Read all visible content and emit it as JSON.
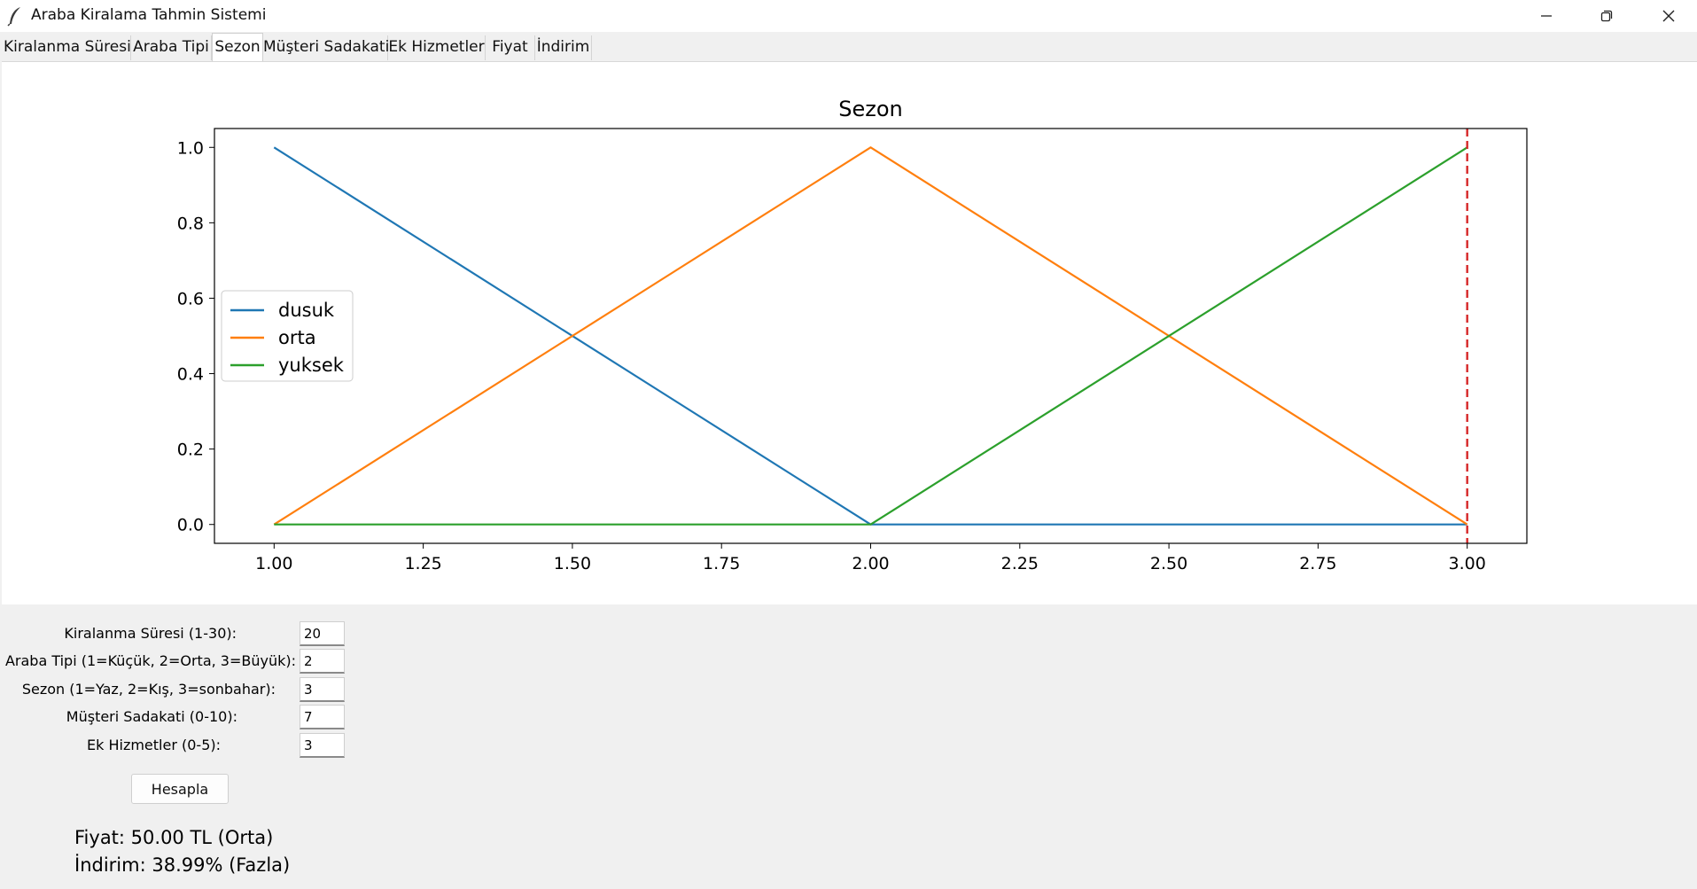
{
  "window": {
    "title": "Araba Kiralama Tahmin Sistemi"
  },
  "tabs": [
    {
      "label": "Kiralanma Süresi",
      "active": false
    },
    {
      "label": "Araba Tipi",
      "active": false
    },
    {
      "label": "Sezon",
      "active": true
    },
    {
      "label": "Müşteri Sadakati",
      "active": false
    },
    {
      "label": "Ek Hizmetler",
      "active": false
    },
    {
      "label": "Fiyat",
      "active": false
    },
    {
      "label": "İndirim",
      "active": false
    }
  ],
  "chart_data": {
    "type": "line",
    "title": "Sezon",
    "xlabel": "",
    "ylabel": "",
    "xlim": [
      0.9,
      3.1
    ],
    "ylim": [
      -0.05,
      1.05
    ],
    "xticks": [
      "1.00",
      "1.25",
      "1.50",
      "1.75",
      "2.00",
      "2.25",
      "2.50",
      "2.75",
      "3.00"
    ],
    "yticks": [
      "0.0",
      "0.2",
      "0.4",
      "0.6",
      "0.8",
      "1.0"
    ],
    "legend_position": "center-left",
    "grid": false,
    "series": [
      {
        "name": "dusuk",
        "color": "#1f77b4",
        "x": [
          1,
          2,
          3
        ],
        "y": [
          1,
          0,
          0
        ]
      },
      {
        "name": "orta",
        "color": "#ff7f0e",
        "x": [
          1,
          2,
          3
        ],
        "y": [
          0,
          1,
          0
        ]
      },
      {
        "name": "yuksek",
        "color": "#2ca02c",
        "x": [
          1,
          2,
          3
        ],
        "y": [
          0,
          0,
          1
        ]
      }
    ],
    "vline": {
      "x": 3.0,
      "color": "#d62728",
      "style": "dashed"
    }
  },
  "form": {
    "fields": [
      {
        "label": "Kiralanma Süresi (1-30):",
        "value": "20"
      },
      {
        "label": "Araba Tipi (1=Küçük, 2=Orta, 3=Büyük):",
        "value": "2"
      },
      {
        "label": "Sezon (1=Yaz, 2=Kış, 3=sonbahar):",
        "value": "3"
      },
      {
        "label": "Müşteri Sadakati (0-10):",
        "value": "7"
      },
      {
        "label": "Ek Hizmetler (0-5):",
        "value": "3"
      }
    ],
    "button_label": "Hesapla"
  },
  "results": {
    "price": "Fiyat: 50.00 TL (Orta)",
    "discount": "İndirim: 38.99% (Fazla)"
  }
}
